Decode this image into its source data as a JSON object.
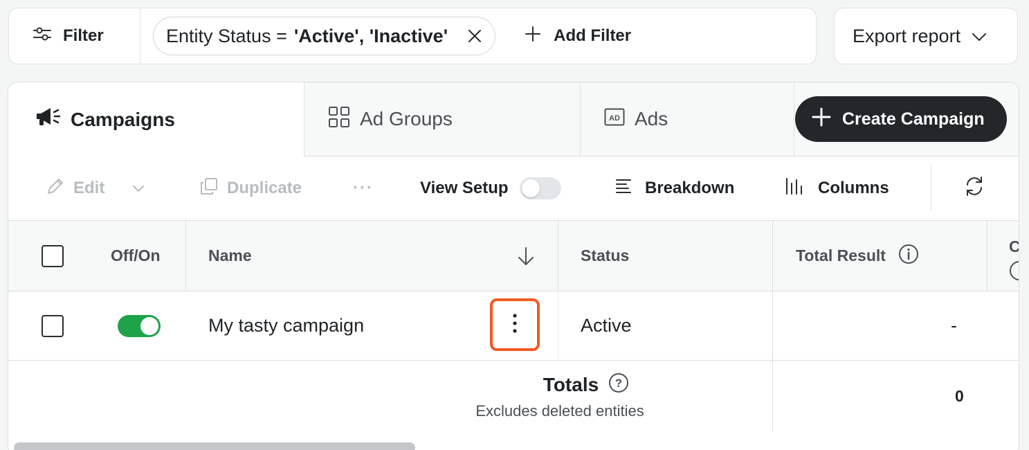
{
  "filter_bar": {
    "filter_label": "Filter",
    "chip": {
      "key": "Entity Status =",
      "value": "'Active', 'Inactive'"
    },
    "add_filter_label": "Add Filter"
  },
  "export": {
    "label": "Export report"
  },
  "tabs": [
    {
      "label": "Campaigns",
      "icon": "megaphone-icon",
      "active": true
    },
    {
      "label": "Ad Groups",
      "icon": "grid-icon",
      "active": false
    },
    {
      "label": "Ads",
      "icon": "ad-icon",
      "active": false
    }
  ],
  "create_button": {
    "label": "Create Campaign"
  },
  "toolbar": {
    "edit": "Edit",
    "duplicate": "Duplicate",
    "more": "···",
    "view_setup": "View Setup",
    "breakdown": "Breakdown",
    "columns": "Columns"
  },
  "table": {
    "headers": {
      "off_on": "Off/On",
      "name": "Name",
      "status": "Status",
      "total_result": "Total Result",
      "next_col_partial": "C"
    },
    "rows": [
      {
        "name": "My tasty campaign",
        "status": "Active",
        "total_result": "-",
        "enabled": true
      }
    ],
    "totals": {
      "label": "Totals",
      "note": "Excludes deleted entities",
      "total_result": "0"
    }
  },
  "colors": {
    "accent_dark": "#232729",
    "toggle_on": "#1fa34a",
    "highlight": "#f15a22"
  }
}
